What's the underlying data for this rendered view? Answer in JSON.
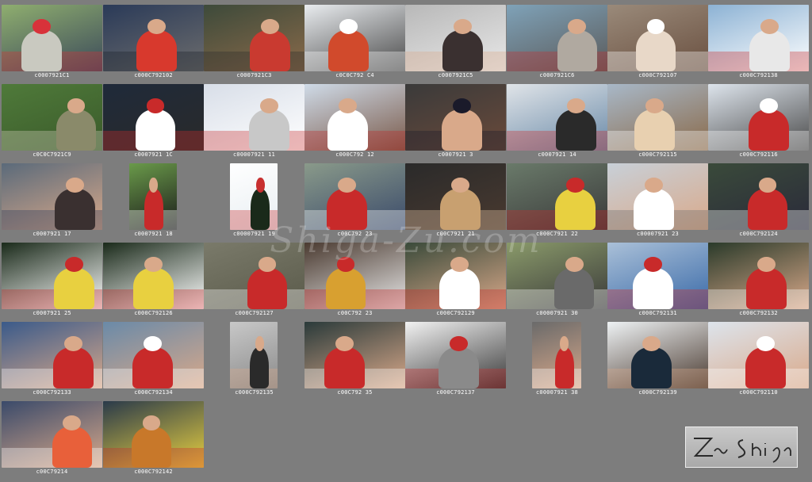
{
  "watermark_text": "Shiga-Zu.com",
  "logo_text": "Zu Shiga",
  "photos": [
    {
      "caption": "c0007921C1",
      "palette": [
        "#8fae6f",
        "#c9c9c0",
        "#d8323a",
        "#3b4a5a"
      ]
    },
    {
      "caption": "c000C792102",
      "palette": [
        "#2a3a58",
        "#d8392d",
        "#1a1f28",
        "#6d6d6d"
      ]
    },
    {
      "caption": "c0007921C3",
      "palette": [
        "#3d4a3a",
        "#c93a30",
        "#2a2a2a",
        "#8a6a4a"
      ]
    },
    {
      "caption": "c0C0C792 C4",
      "palette": [
        "#e9ecef",
        "#d14a2c",
        "#ffffff",
        "#4a4a4a"
      ]
    },
    {
      "caption": "c0007921C5",
      "palette": [
        "#b8b8b8",
        "#3a3030",
        "#d9a98a",
        "#e8e8e8"
      ]
    },
    {
      "caption": "c0007921C6",
      "palette": [
        "#7fa2b8",
        "#b0a9a0",
        "#c43030",
        "#5a5a5a"
      ]
    },
    {
      "caption": "c000C792107",
      "palette": [
        "#9a8a7a",
        "#e8d8c8",
        "#ffffff",
        "#6a5040"
      ]
    },
    {
      "caption": "c000C792138",
      "palette": [
        "#8cb2d4",
        "#e8e8e8",
        "#c83030",
        "#ffffff"
      ]
    },
    {
      "caption": "c0C0C7921C9",
      "palette": [
        "#4f7a3a",
        "#8a8a6a",
        "#d8d0c0",
        "#3a5a2a"
      ]
    },
    {
      "caption": "c0007921 1C",
      "palette": [
        "#1f2a3a",
        "#ffffff",
        "#c82a2a",
        "#2a2a2a"
      ]
    },
    {
      "caption": "c00007921 11",
      "palette": [
        "#d8dee8",
        "#c8c8c8",
        "#c83030",
        "#ffffff"
      ]
    },
    {
      "caption": "c000C792 12",
      "palette": [
        "#cfdbe8",
        "#ffffff",
        "#c02a2a",
        "#7a5a4a"
      ]
    },
    {
      "caption": "c0007921 3",
      "palette": [
        "#3a3a3a",
        "#d9a98a",
        "#1a1a2a",
        "#6a4a3a"
      ]
    },
    {
      "caption": "c0007921 14",
      "palette": [
        "#e0e4e8",
        "#2a2a2a",
        "#c83030",
        "#6a8aa8"
      ]
    },
    {
      "caption": "c000C792115",
      "palette": [
        "#a8b8c8",
        "#e8d0b0",
        "#ffffff",
        "#8a6a4a"
      ]
    },
    {
      "caption": "c000C792116",
      "palette": [
        "#dde4ec",
        "#c82a2a",
        "#ffffff",
        "#4a4a4a"
      ]
    },
    {
      "caption": "c0007921 17",
      "palette": [
        "#5a6a7a",
        "#3a3030",
        "#2a3a5a",
        "#d9a98a"
      ]
    },
    {
      "caption": "c0007921 18",
      "palette": [
        "#6a9a4a",
        "#c82a2a",
        "#ffffff",
        "#1a1a1a"
      ]
    },
    {
      "caption": "c00007921 19",
      "palette": [
        "#ffffff",
        "#1a2a1a",
        "#c83030",
        "#e8eef2"
      ]
    },
    {
      "caption": "c00C792 23",
      "palette": [
        "#8a9a8a",
        "#c82a2a",
        "#ffffff",
        "#3a4a6a"
      ]
    },
    {
      "caption": "c00C7921 21",
      "palette": [
        "#2a2a2a",
        "#c8a070",
        "#e8c8a8",
        "#4a3a30"
      ]
    },
    {
      "caption": "c000C7921 22",
      "palette": [
        "#6a7a6a",
        "#e8d040",
        "#c82a2a",
        "#3a3a3a"
      ]
    },
    {
      "caption": "c00007921 23",
      "palette": [
        "#c8d0d8",
        "#ffffff",
        "#6a6a6a",
        "#d9a98a"
      ]
    },
    {
      "caption": "c000C792124",
      "palette": [
        "#3a4a3a",
        "#c82a2a",
        "#ffffff",
        "#2a2a3a"
      ]
    },
    {
      "caption": "c0007921 25",
      "palette": [
        "#1a2a1a",
        "#e8d040",
        "#c82a2a",
        "#ffffff"
      ]
    },
    {
      "caption": "c000C792126",
      "palette": [
        "#1a2a1a",
        "#e8d040",
        "#c82a2a",
        "#ffffff"
      ]
    },
    {
      "caption": "c000C792127",
      "palette": [
        "#7a7a6a",
        "#c82a2a",
        "#ffffff",
        "#5a5a4a"
      ]
    },
    {
      "caption": "c00C792 23",
      "palette": [
        "#4a3a30",
        "#d8a030",
        "#c82a2a",
        "#e8e8e8"
      ]
    },
    {
      "caption": "c000C792129",
      "palette": [
        "#3a4a3a",
        "#ffffff",
        "#c82a2a",
        "#d9a98a"
      ]
    },
    {
      "caption": "c00007921 30",
      "palette": [
        "#8a9a6a",
        "#6a6a6a",
        "#ffffff",
        "#3a3a3a"
      ]
    },
    {
      "caption": "c000C792131",
      "palette": [
        "#aac0d8",
        "#ffffff",
        "#c82a2a",
        "#3a6aa8"
      ]
    },
    {
      "caption": "c000C792132",
      "palette": [
        "#2a3a2a",
        "#c82a2a",
        "#ffffff",
        "#d9a98a"
      ]
    },
    {
      "caption": "c000C792133",
      "palette": [
        "#3a5a8a",
        "#c82a2a",
        "#ffffff",
        "#d9a98a"
      ]
    },
    {
      "caption": "c000C792134",
      "palette": [
        "#6a8aa8",
        "#c82a2a",
        "#ffffff",
        "#d9a98a"
      ]
    },
    {
      "caption": "c000C792135",
      "palette": [
        "#c8c8c8",
        "#2a2a2a",
        "#d9a98a",
        "#8a8a8a"
      ]
    },
    {
      "caption": "c00C792 35",
      "palette": [
        "#2a3a3a",
        "#c82a2a",
        "#ffffff",
        "#d9a98a"
      ]
    },
    {
      "caption": "c000C792137",
      "palette": [
        "#f2f2f2",
        "#8a8a8a",
        "#c82a2a",
        "#3a3a3a"
      ]
    },
    {
      "caption": "c00007921 38",
      "palette": [
        "#6a6a6a",
        "#c82a2a",
        "#ffffff",
        "#d9a98a"
      ]
    },
    {
      "caption": "c000C792139",
      "palette": [
        "#eef2f4",
        "#1a2a3a",
        "#d9a98a",
        "#4a3a30"
      ]
    },
    {
      "caption": "c000C792110",
      "palette": [
        "#dde4ec",
        "#c82a2a",
        "#ffffff",
        "#d9a98a"
      ]
    },
    {
      "caption": "c00C79214",
      "palette": [
        "#3a4a6a",
        "#e8603a",
        "#ffffff",
        "#d9a98a"
      ]
    },
    {
      "caption": "c000C792142",
      "palette": [
        "#2a3a4a",
        "#c8782a",
        "#c82a2a",
        "#e8d040"
      ]
    }
  ]
}
